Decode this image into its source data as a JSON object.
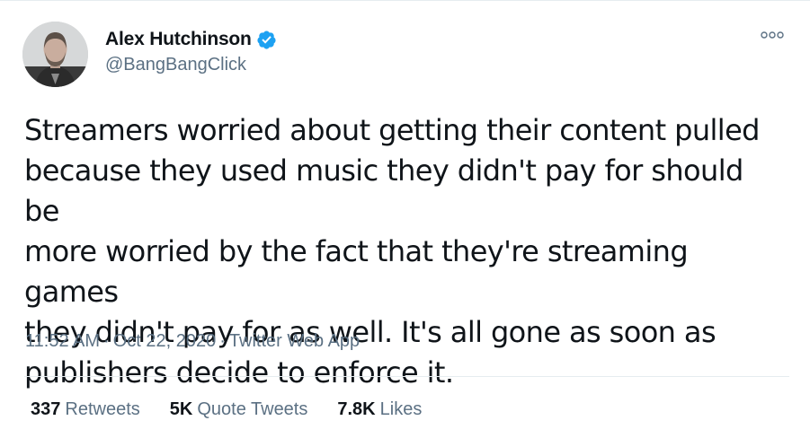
{
  "user": {
    "display_name": "Alex Hutchinson",
    "handle": "@BangBangClick",
    "verified": true
  },
  "tweet": {
    "text": "Streamers worried about getting their content pulled\nbecause they used music they didn't pay for should be\nmore worried by the fact that they're streaming games\nthey didn't pay for as well. It's all gone as soon as\npublishers decide to enforce it.",
    "time": "11:52 AM",
    "date": "Oct 22, 2020",
    "source": "Twitter Web App",
    "separator": "·"
  },
  "stats": {
    "retweets": {
      "count": "337",
      "label": "Retweets"
    },
    "quote_tweets": {
      "count": "5K",
      "label": "Quote Tweets"
    },
    "likes": {
      "count": "7.8K",
      "label": "Likes"
    }
  },
  "icons": {
    "verified": "verified-badge-icon",
    "more": "more-options-icon"
  },
  "colors": {
    "verified_blue": "#1da1f2",
    "secondary_text": "#5b7083",
    "primary_text": "#0f1419"
  }
}
